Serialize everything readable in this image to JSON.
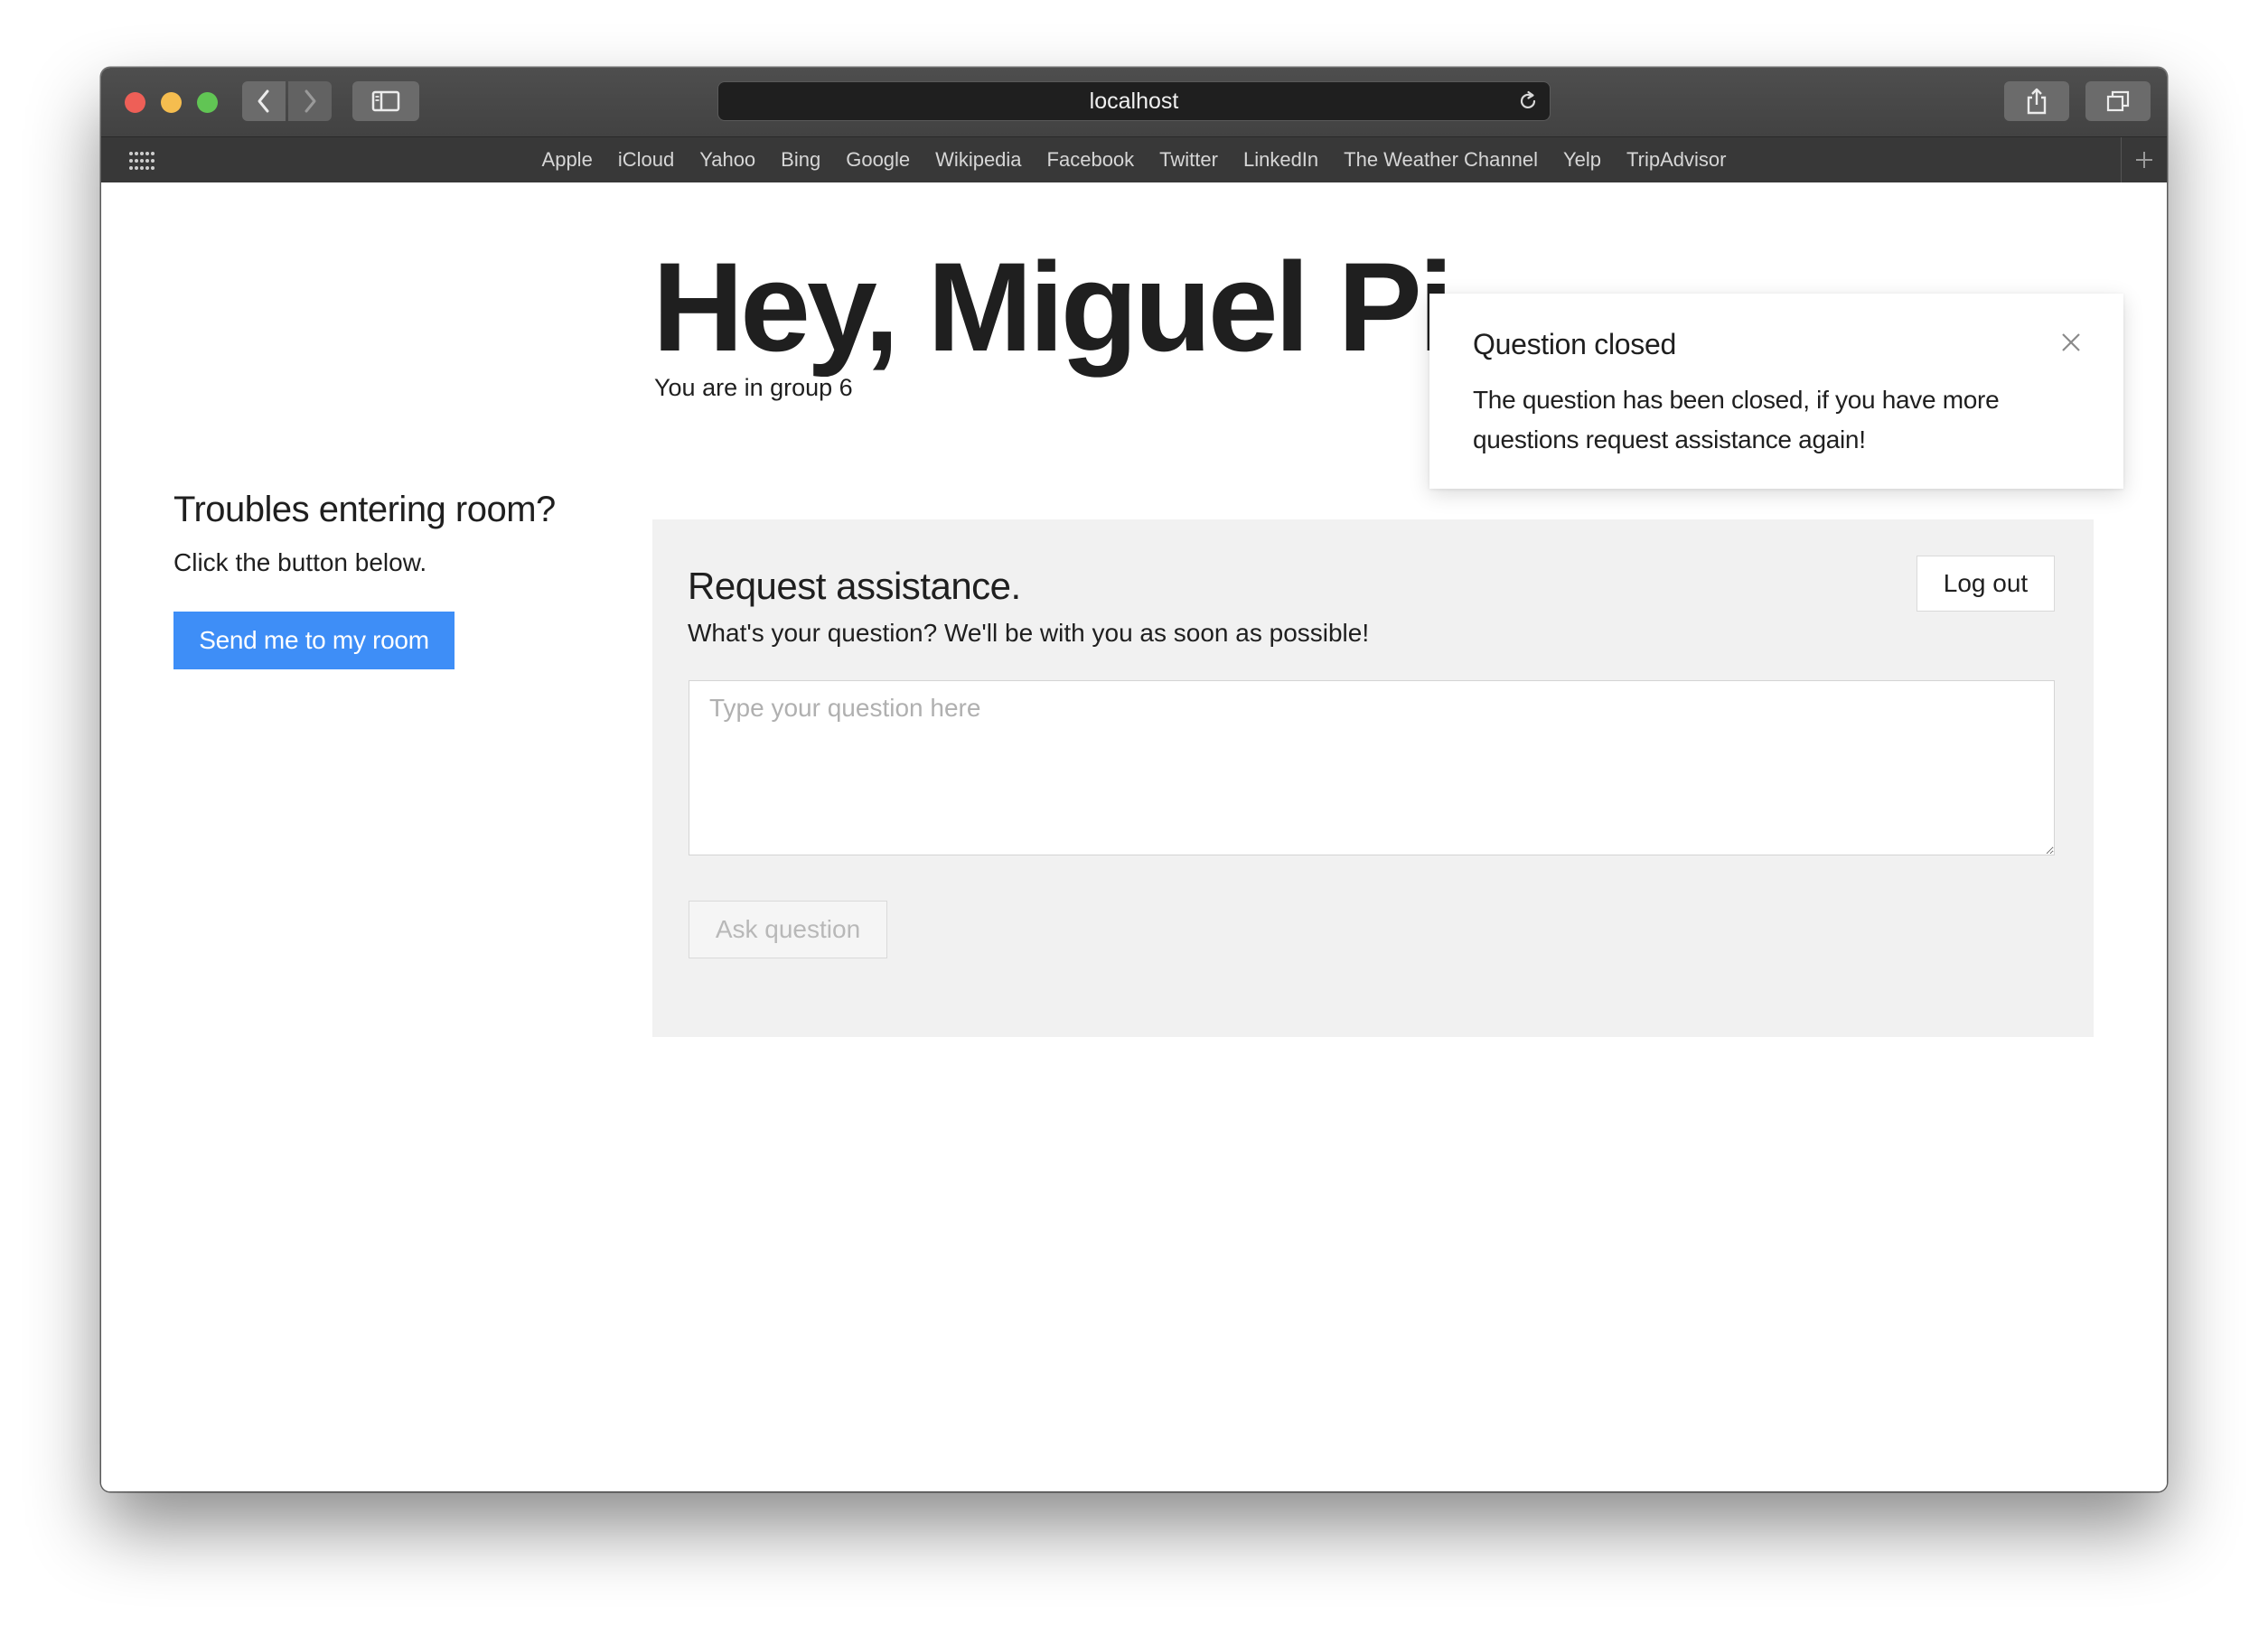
{
  "browser": {
    "url": "localhost",
    "bookmarks": [
      "Apple",
      "iCloud",
      "Yahoo",
      "Bing",
      "Google",
      "Wikipedia",
      "Facebook",
      "Twitter",
      "LinkedIn",
      "The Weather Channel",
      "Yelp",
      "TripAdvisor"
    ],
    "icons": {
      "back": "chevron-left-icon",
      "forward": "chevron-right-icon",
      "sidebar": "sidebar-icon",
      "reload": "reload-icon",
      "share": "share-icon",
      "tabs": "tabs-icon",
      "apps": "grid-icon",
      "new_tab": "plus-icon"
    }
  },
  "page": {
    "greeting": "Hey, Miguel Pi",
    "group_line": "You are in group 6"
  },
  "sidebar": {
    "title": "Troubles entering room?",
    "subtitle": "Click the button below.",
    "button_label": "Send me to my room"
  },
  "panel": {
    "title": "Request assistance.",
    "subtitle": "What's your question? We'll be with you as soon as possible!",
    "logout_label": "Log out",
    "question_value": "",
    "question_placeholder": "Type your question here",
    "ask_label": "Ask question"
  },
  "toast": {
    "title": "Question closed",
    "message": "The question has been closed, if you have more questions request assistance again!"
  },
  "colors": {
    "primary_button": "#3e8ef7",
    "panel_background": "#f1f1f1",
    "text": "#1f1f1f",
    "titlebar": "#4a4a4a",
    "bookmarks_bar": "#383838"
  }
}
